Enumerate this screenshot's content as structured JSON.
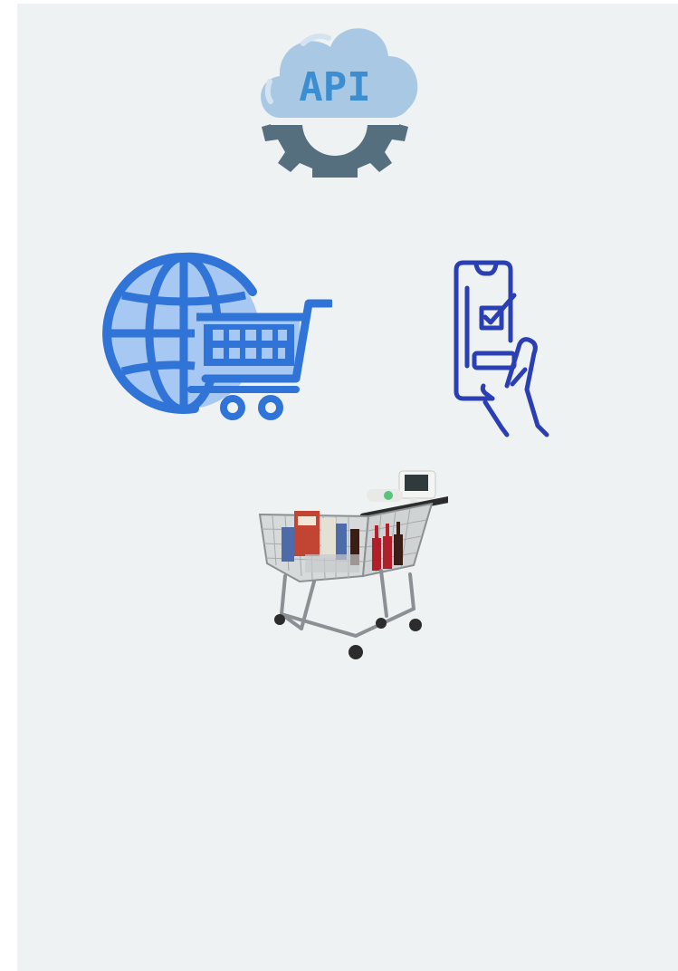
{
  "api_icon": {
    "label": "API",
    "colors": {
      "cloud": "#a9c8e4",
      "cloud_highlight": "#d3e3f1",
      "text": "#3d8ed0",
      "gear": "#556f7f"
    }
  },
  "globe_cart_icon": {
    "colors": {
      "globe_fill": "#a6c8f2",
      "stroke": "#2f74d6"
    }
  },
  "phone_check_icon": {
    "colors": {
      "stroke": "#2b3fb5"
    }
  },
  "smart_cart_photo": {
    "colors": {
      "frame": "#8c8f93",
      "screen_body": "#f4f4f2",
      "screen": "#2f3a3c",
      "bottle_red": "#b1202a",
      "bottle_dark": "#3a1d14",
      "box_blue": "#4d6aa9",
      "box_red": "#c24433",
      "wheel": "#2c2c2c",
      "accent_green": "#58c47a"
    }
  }
}
